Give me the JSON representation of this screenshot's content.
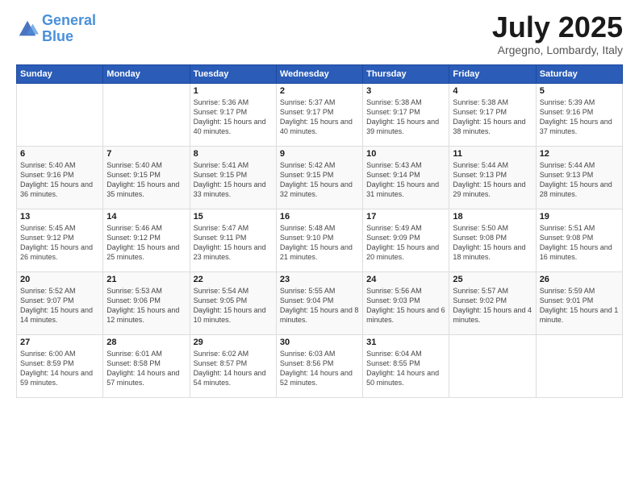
{
  "header": {
    "logo_line1": "General",
    "logo_line2": "Blue",
    "month": "July 2025",
    "location": "Argegno, Lombardy, Italy"
  },
  "weekdays": [
    "Sunday",
    "Monday",
    "Tuesday",
    "Wednesday",
    "Thursday",
    "Friday",
    "Saturday"
  ],
  "weeks": [
    [
      {
        "day": "",
        "info": ""
      },
      {
        "day": "",
        "info": ""
      },
      {
        "day": "1",
        "info": "Sunrise: 5:36 AM\nSunset: 9:17 PM\nDaylight: 15 hours\nand 40 minutes."
      },
      {
        "day": "2",
        "info": "Sunrise: 5:37 AM\nSunset: 9:17 PM\nDaylight: 15 hours\nand 40 minutes."
      },
      {
        "day": "3",
        "info": "Sunrise: 5:38 AM\nSunset: 9:17 PM\nDaylight: 15 hours\nand 39 minutes."
      },
      {
        "day": "4",
        "info": "Sunrise: 5:38 AM\nSunset: 9:17 PM\nDaylight: 15 hours\nand 38 minutes."
      },
      {
        "day": "5",
        "info": "Sunrise: 5:39 AM\nSunset: 9:16 PM\nDaylight: 15 hours\nand 37 minutes."
      }
    ],
    [
      {
        "day": "6",
        "info": "Sunrise: 5:40 AM\nSunset: 9:16 PM\nDaylight: 15 hours\nand 36 minutes."
      },
      {
        "day": "7",
        "info": "Sunrise: 5:40 AM\nSunset: 9:15 PM\nDaylight: 15 hours\nand 35 minutes."
      },
      {
        "day": "8",
        "info": "Sunrise: 5:41 AM\nSunset: 9:15 PM\nDaylight: 15 hours\nand 33 minutes."
      },
      {
        "day": "9",
        "info": "Sunrise: 5:42 AM\nSunset: 9:15 PM\nDaylight: 15 hours\nand 32 minutes."
      },
      {
        "day": "10",
        "info": "Sunrise: 5:43 AM\nSunset: 9:14 PM\nDaylight: 15 hours\nand 31 minutes."
      },
      {
        "day": "11",
        "info": "Sunrise: 5:44 AM\nSunset: 9:13 PM\nDaylight: 15 hours\nand 29 minutes."
      },
      {
        "day": "12",
        "info": "Sunrise: 5:44 AM\nSunset: 9:13 PM\nDaylight: 15 hours\nand 28 minutes."
      }
    ],
    [
      {
        "day": "13",
        "info": "Sunrise: 5:45 AM\nSunset: 9:12 PM\nDaylight: 15 hours\nand 26 minutes."
      },
      {
        "day": "14",
        "info": "Sunrise: 5:46 AM\nSunset: 9:12 PM\nDaylight: 15 hours\nand 25 minutes."
      },
      {
        "day": "15",
        "info": "Sunrise: 5:47 AM\nSunset: 9:11 PM\nDaylight: 15 hours\nand 23 minutes."
      },
      {
        "day": "16",
        "info": "Sunrise: 5:48 AM\nSunset: 9:10 PM\nDaylight: 15 hours\nand 21 minutes."
      },
      {
        "day": "17",
        "info": "Sunrise: 5:49 AM\nSunset: 9:09 PM\nDaylight: 15 hours\nand 20 minutes."
      },
      {
        "day": "18",
        "info": "Sunrise: 5:50 AM\nSunset: 9:08 PM\nDaylight: 15 hours\nand 18 minutes."
      },
      {
        "day": "19",
        "info": "Sunrise: 5:51 AM\nSunset: 9:08 PM\nDaylight: 15 hours\nand 16 minutes."
      }
    ],
    [
      {
        "day": "20",
        "info": "Sunrise: 5:52 AM\nSunset: 9:07 PM\nDaylight: 15 hours\nand 14 minutes."
      },
      {
        "day": "21",
        "info": "Sunrise: 5:53 AM\nSunset: 9:06 PM\nDaylight: 15 hours\nand 12 minutes."
      },
      {
        "day": "22",
        "info": "Sunrise: 5:54 AM\nSunset: 9:05 PM\nDaylight: 15 hours\nand 10 minutes."
      },
      {
        "day": "23",
        "info": "Sunrise: 5:55 AM\nSunset: 9:04 PM\nDaylight: 15 hours\nand 8 minutes."
      },
      {
        "day": "24",
        "info": "Sunrise: 5:56 AM\nSunset: 9:03 PM\nDaylight: 15 hours\nand 6 minutes."
      },
      {
        "day": "25",
        "info": "Sunrise: 5:57 AM\nSunset: 9:02 PM\nDaylight: 15 hours\nand 4 minutes."
      },
      {
        "day": "26",
        "info": "Sunrise: 5:59 AM\nSunset: 9:01 PM\nDaylight: 15 hours\nand 1 minute."
      }
    ],
    [
      {
        "day": "27",
        "info": "Sunrise: 6:00 AM\nSunset: 8:59 PM\nDaylight: 14 hours\nand 59 minutes."
      },
      {
        "day": "28",
        "info": "Sunrise: 6:01 AM\nSunset: 8:58 PM\nDaylight: 14 hours\nand 57 minutes."
      },
      {
        "day": "29",
        "info": "Sunrise: 6:02 AM\nSunset: 8:57 PM\nDaylight: 14 hours\nand 54 minutes."
      },
      {
        "day": "30",
        "info": "Sunrise: 6:03 AM\nSunset: 8:56 PM\nDaylight: 14 hours\nand 52 minutes."
      },
      {
        "day": "31",
        "info": "Sunrise: 6:04 AM\nSunset: 8:55 PM\nDaylight: 14 hours\nand 50 minutes."
      },
      {
        "day": "",
        "info": ""
      },
      {
        "day": "",
        "info": ""
      }
    ]
  ]
}
